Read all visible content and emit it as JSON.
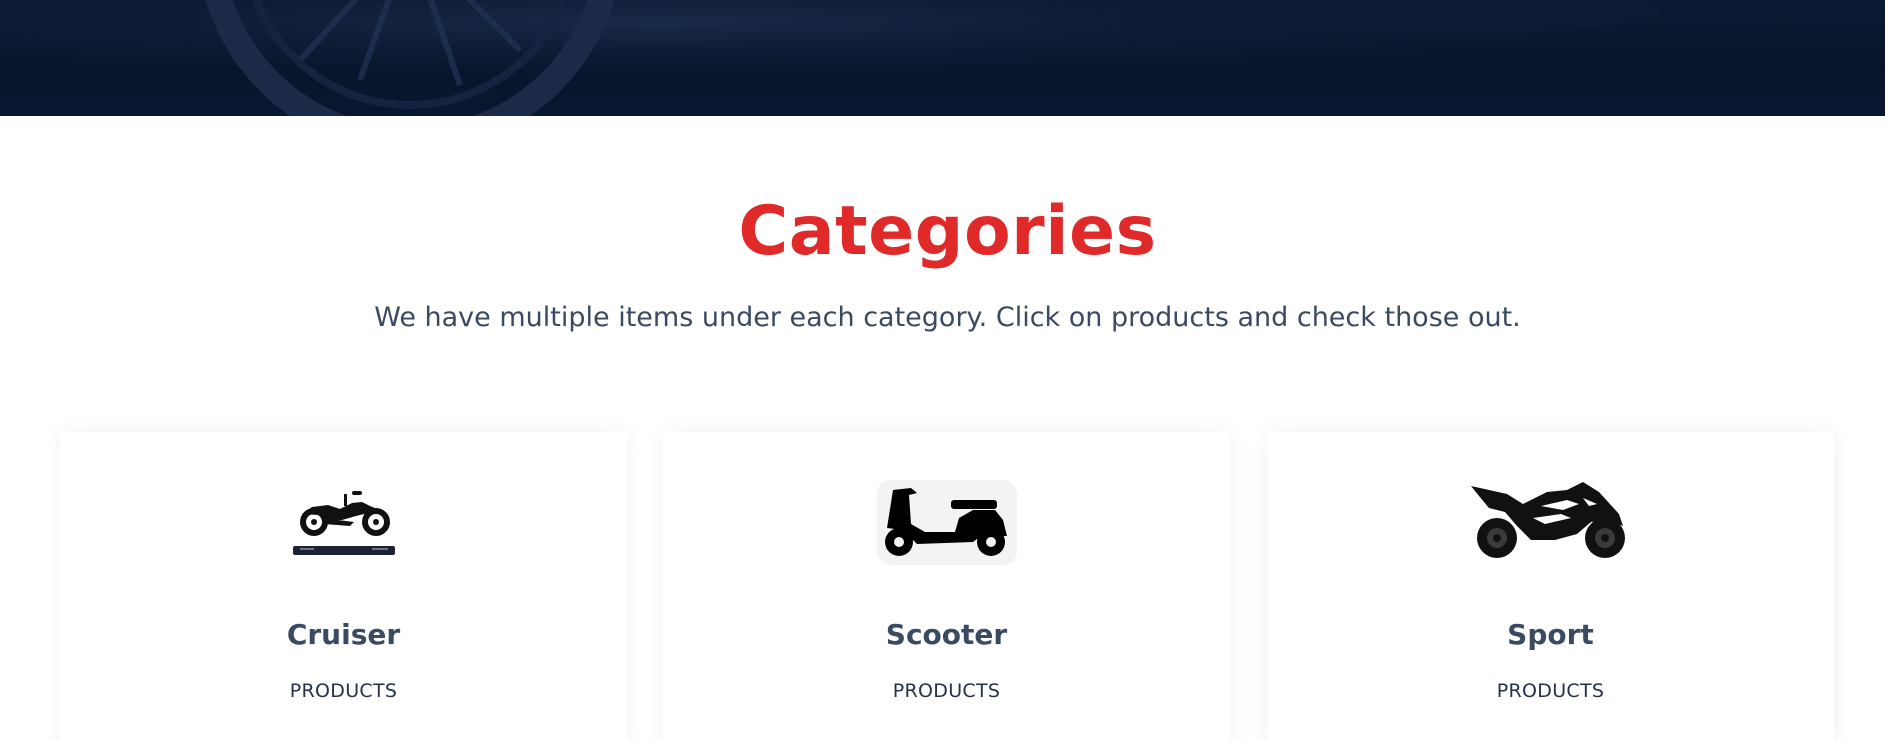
{
  "hero": {
    "background_color": "#07142b",
    "image": "motorcycle-wheel-banner"
  },
  "categories_section": {
    "title": "Categories",
    "subtitle": "We have multiple items under each category. Click on products and check those out.",
    "title_color": "#e02a2a",
    "text_color": "#3a4a63",
    "cards": [
      {
        "name": "Cruiser",
        "link_label": "PRODUCTS",
        "icon": "cruiser-motorcycle-icon"
      },
      {
        "name": "Scooter",
        "link_label": "PRODUCTS",
        "icon": "scooter-icon"
      },
      {
        "name": "Sport",
        "link_label": "PRODUCTS",
        "icon": "sport-motorcycle-icon"
      }
    ]
  }
}
